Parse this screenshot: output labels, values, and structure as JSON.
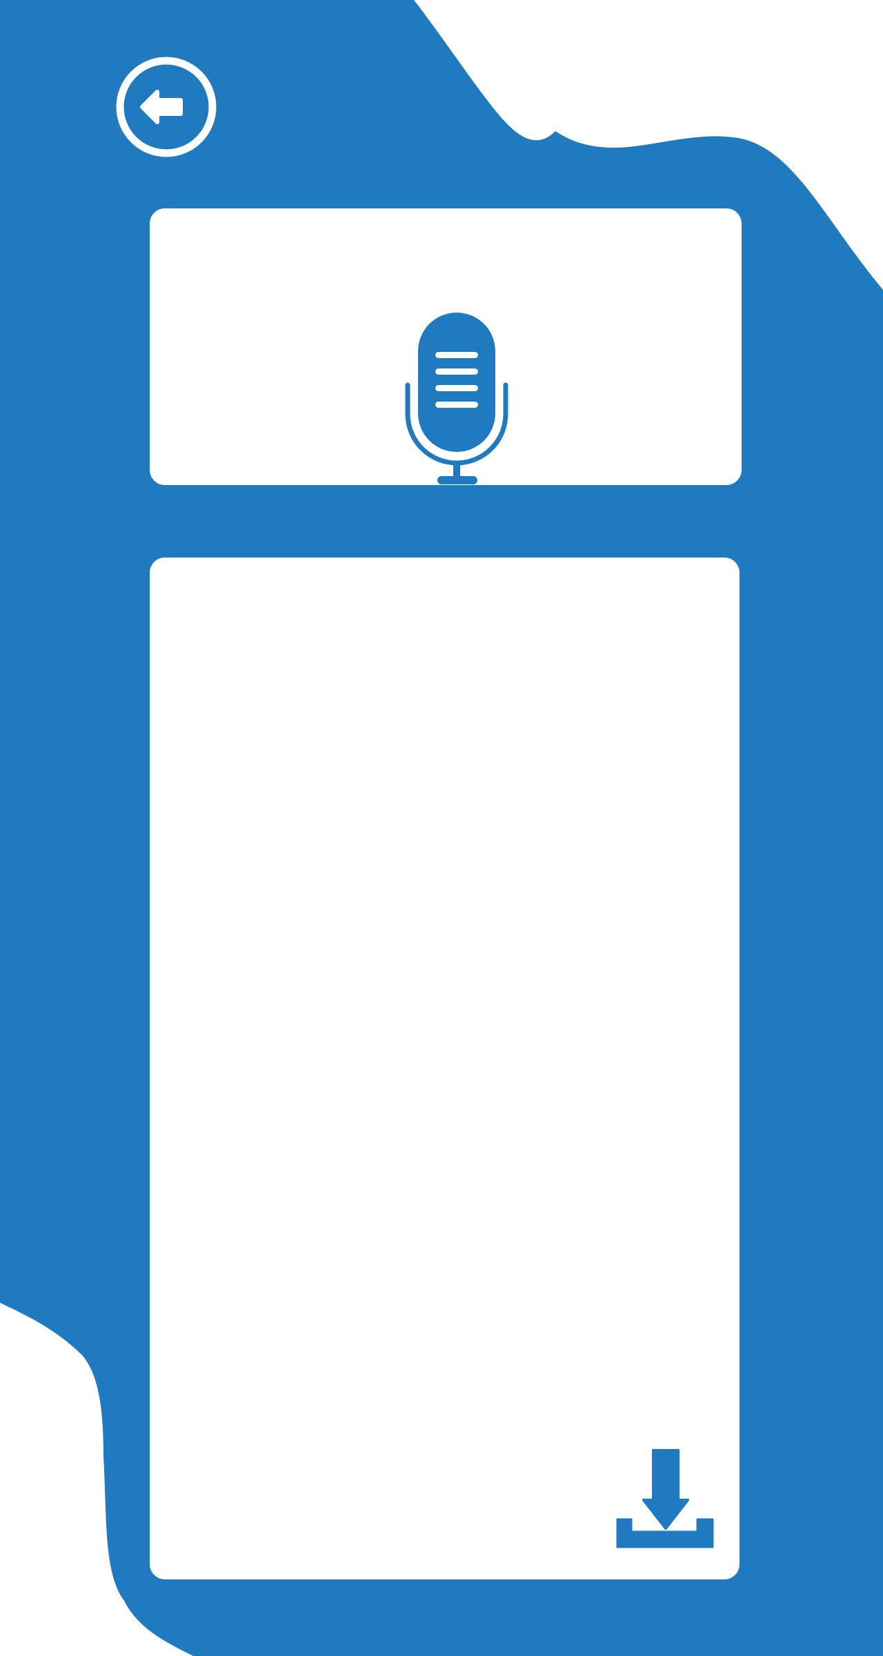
{
  "theme": {
    "primary_color": "#207abf",
    "surface_color": "#ffffff"
  },
  "header": {
    "back_button_icon": "arrow-left-circle-icon"
  },
  "recorder": {
    "mic_button_icon": "microphone-icon"
  },
  "transcript": {
    "text": ""
  },
  "actions": {
    "download_button_icon": "download-icon"
  }
}
